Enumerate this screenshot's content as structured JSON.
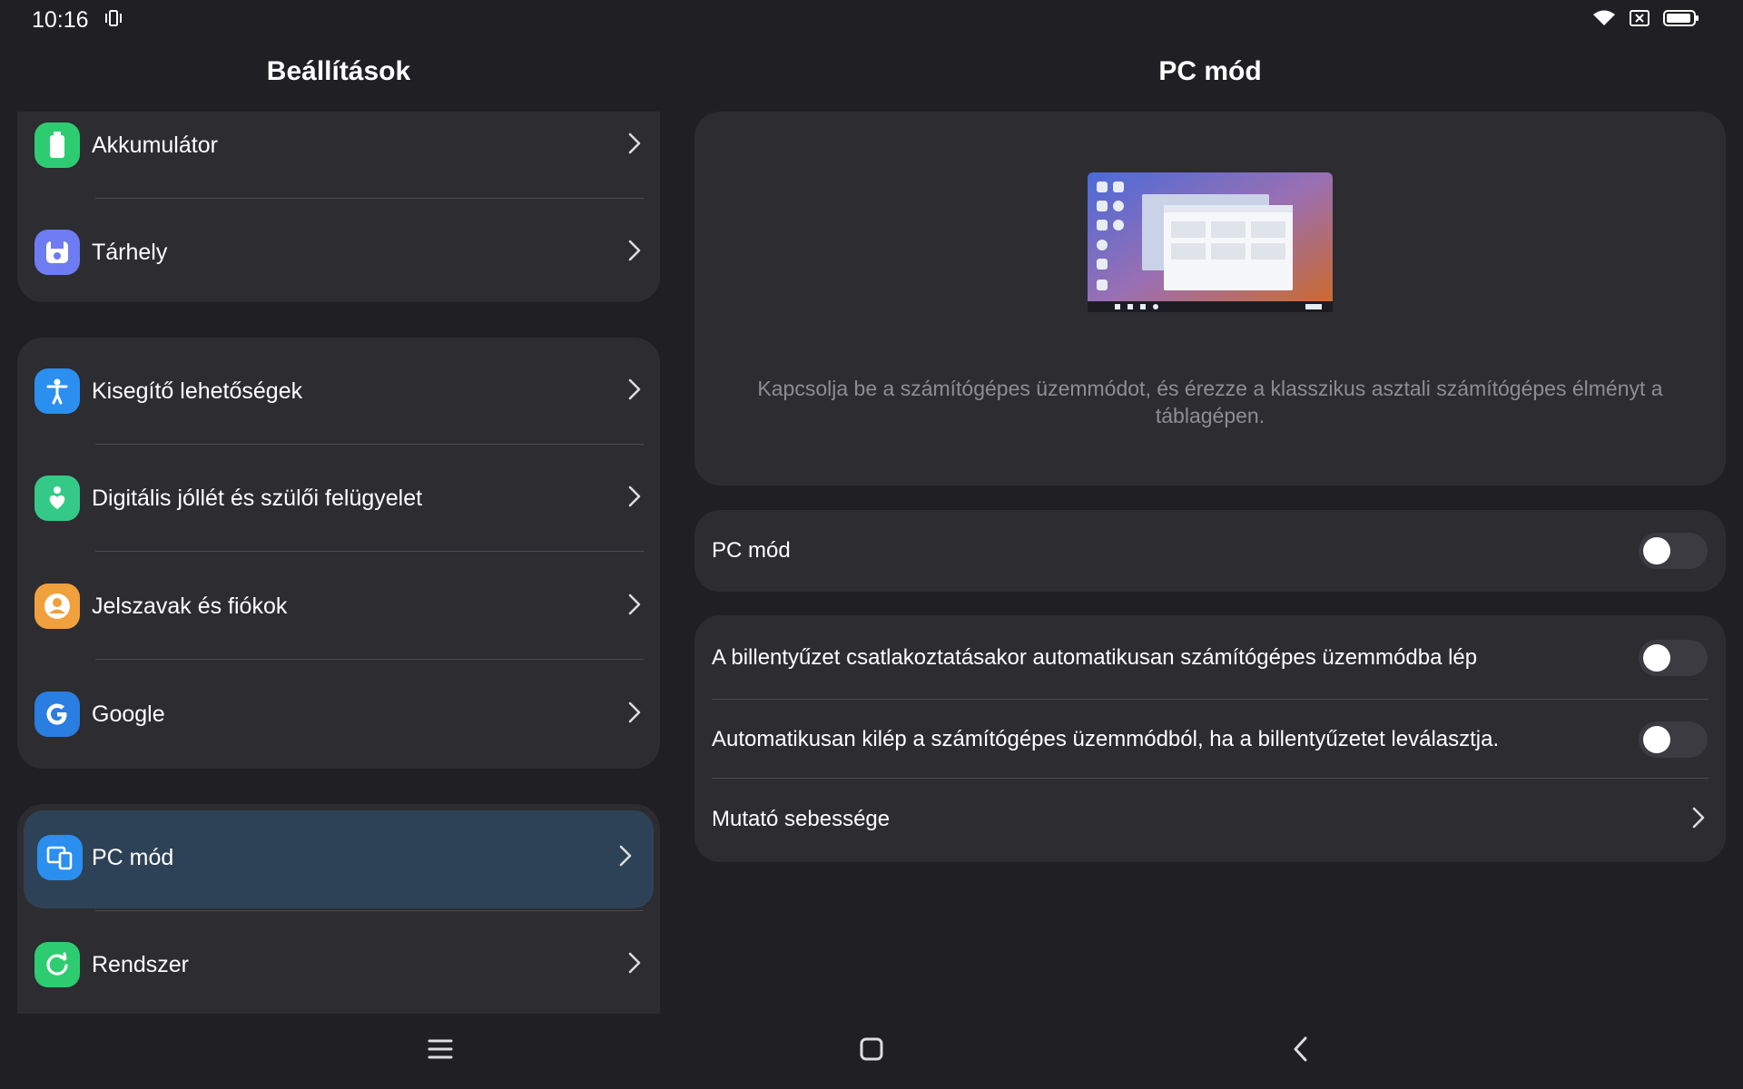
{
  "status": {
    "time": "10:16"
  },
  "left": {
    "title": "Beállítások",
    "items": [
      {
        "label": "Akkumulátor",
        "icon": "battery-icon",
        "color": "#2ecc71"
      },
      {
        "label": "Tárhely",
        "icon": "storage-icon",
        "color": "#6d7cf0"
      },
      {
        "label": "Kisegítő lehetőségek",
        "icon": "accessibility-icon",
        "color": "#2b8fef"
      },
      {
        "label": "Digitális jóllét és szülői felügyelet",
        "icon": "wellbeing-icon",
        "color": "#35c987"
      },
      {
        "label": "Jelszavak és fiókok",
        "icon": "account-icon",
        "color": "#f0a03c"
      },
      {
        "label": "Google",
        "icon": "google-icon",
        "color": "#2a7de1"
      },
      {
        "label": "PC mód",
        "icon": "pc-mode-icon",
        "color": "#2b8fef",
        "selected": true
      },
      {
        "label": "Rendszer",
        "icon": "system-icon",
        "color": "#2ecc71"
      }
    ]
  },
  "right": {
    "title": "PC mód",
    "description": "Kapcsolja be a számítógépes üzemmódot, és érezze a klasszikus asztali számítógépes élményt a táblagépen.",
    "pc_mode_label": "PC mód",
    "pc_mode_on": false,
    "options": [
      {
        "label": "A billentyűzet csatlakoztatásakor automatikusan számítógépes üzemmódba lép",
        "on": false
      },
      {
        "label": "Automatikusan kilép a számítógépes üzemmódból, ha a billentyűzetet leválasztja.",
        "on": false
      }
    ],
    "pointer_speed_label": "Mutató sebessége"
  }
}
